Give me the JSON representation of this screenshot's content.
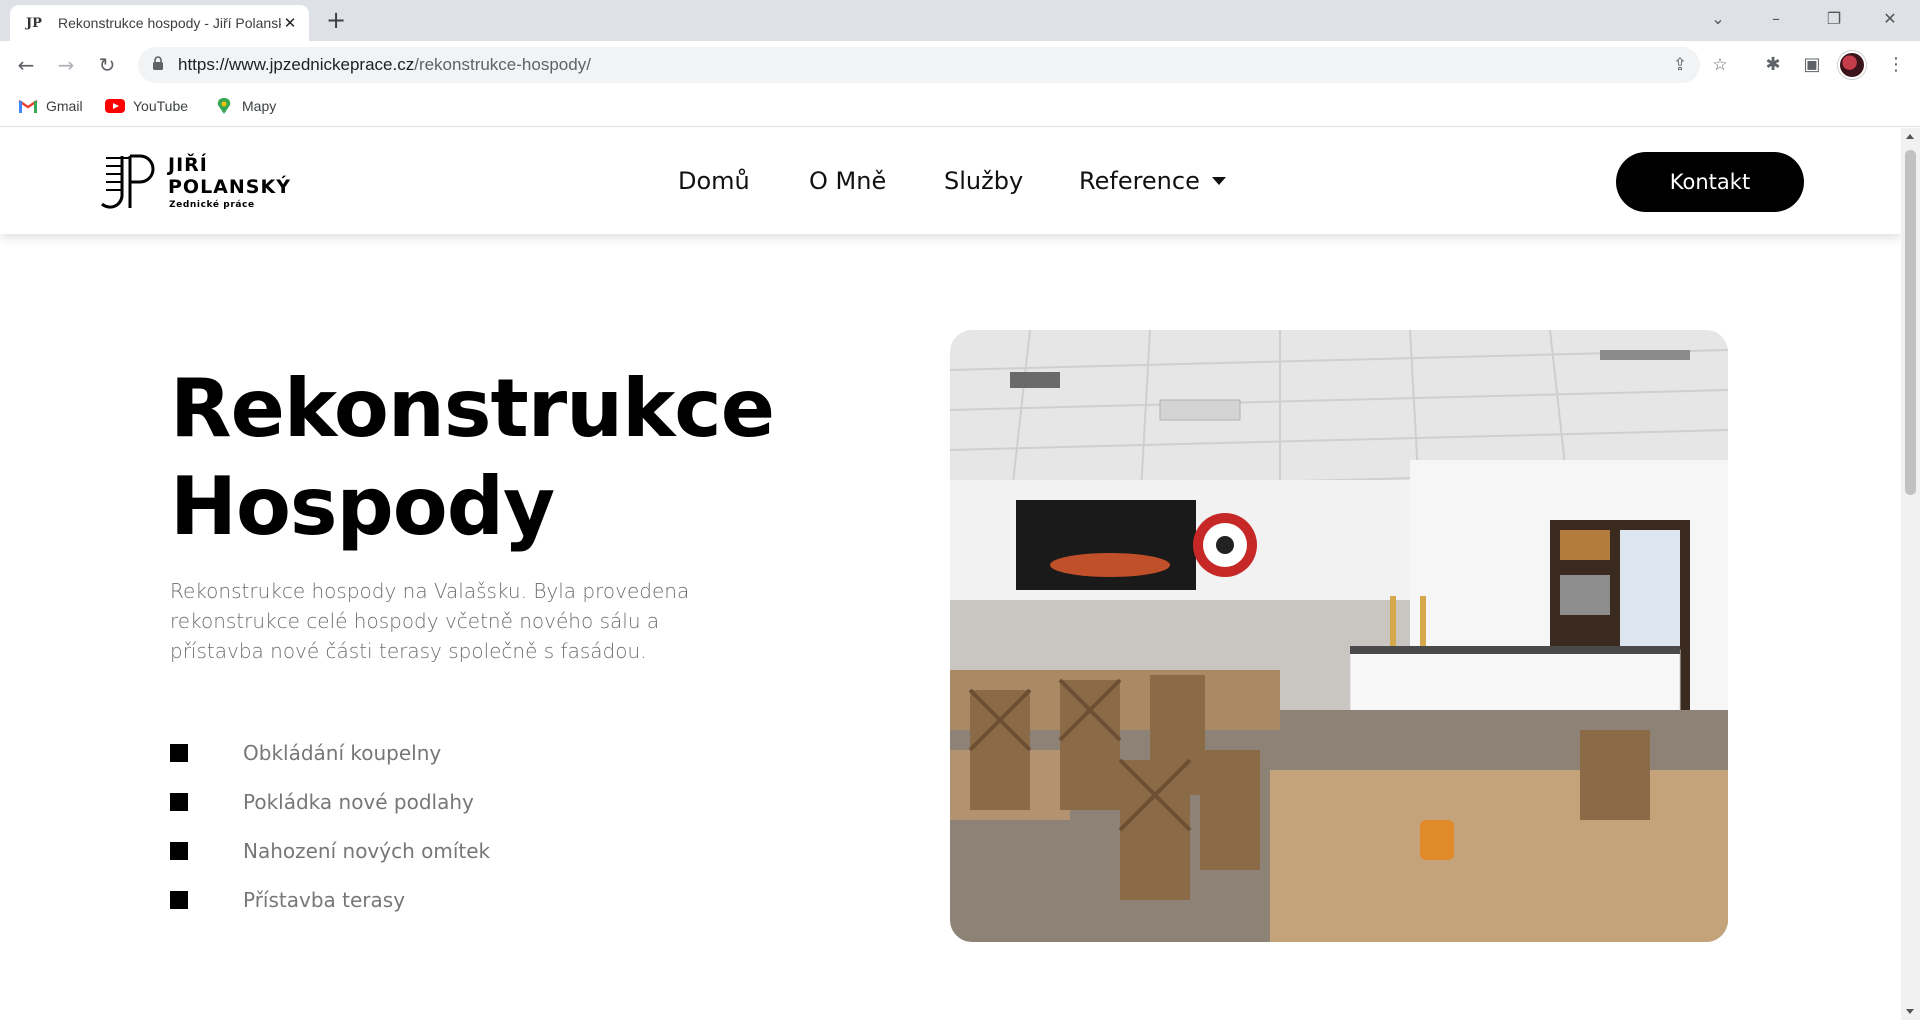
{
  "browser": {
    "tab_title": "Rekonstrukce hospody - Jiří Polansk",
    "tab_favicon": "JP",
    "url_domain": "https://www.jpzednickeprace.cz",
    "url_path": "/rekonstrukce-hospody/",
    "bookmarks": [
      {
        "label": "Gmail",
        "icon": "gmail-icon"
      },
      {
        "label": "YouTube",
        "icon": "youtube-icon"
      },
      {
        "label": "Mapy",
        "icon": "maps-pin-icon"
      }
    ]
  },
  "site": {
    "logo": {
      "line1": "JIŘÍ",
      "line2": "POLANSKÝ",
      "tagline": "Zednické práce"
    },
    "nav": [
      {
        "label": "Domů"
      },
      {
        "label": "O Mně"
      },
      {
        "label": "Služby"
      },
      {
        "label": "Reference"
      }
    ],
    "cta_label": "Kontakt"
  },
  "hero": {
    "title_line1": "Rekonstrukce",
    "title_line2": "Hospody",
    "description": "Rekonstrukce hospody na Valašsku. Byla provedena rekonstrukce celé hospody včetně nového sálu a přístavba nové části terasy společně s fasádou.",
    "features": [
      "Obkládání koupelny",
      "Pokládka nové podlahy",
      "Nahození nových omítek",
      "Přístavba terasy"
    ]
  },
  "colors": {
    "accent": "#000000",
    "muted_text": "#6e6e6e",
    "tabstrip": "#dee1e6"
  }
}
